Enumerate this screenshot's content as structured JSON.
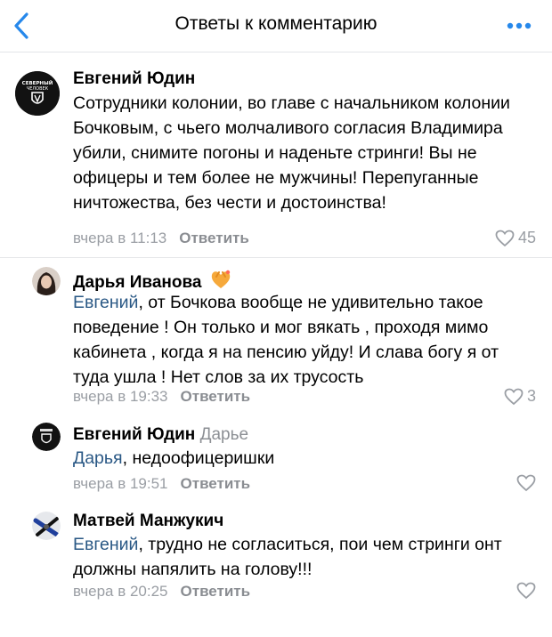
{
  "header": {
    "title": "Ответы к комментарию"
  },
  "comments": [
    {
      "author": "Евгений Юдин",
      "reply_to": "",
      "mention": "",
      "text": "Сотрудники колонии, во главе с начальником колонии Бочковым, с чьего молчаливого согласия Владимира убили, снимите погоны и наденьте стринги! Вы не офицеры и тем более не мужчины! Перепуганные ничтожества, без чести и достоинства!",
      "time": "вчера в 11:13",
      "reply_label": "Ответить",
      "likes": "45",
      "avatar_icon": "group-logo-icon",
      "avatar_text": "СЕВЕРНЫЙ ЧЕЛОВЕК"
    },
    {
      "author": "Дарья Иванова",
      "reply_to": "",
      "mention": "Евгений",
      "text": ", от Бочкова вообще не удивительно такое поведение ! Он только и мог вякать , проходя мимо кабинета , когда я на пенсию уйду! И слава богу я от туда ушла ! Нет слов за их трусость",
      "time": "вчера в 19:33",
      "reply_label": "Ответить",
      "likes": "3",
      "avatar_icon": "user-photo-icon",
      "badge_icon": "heart-hands-emoji-icon"
    },
    {
      "author": "Евгений Юдин",
      "reply_to": "Дарье",
      "mention": "Дарья",
      "text": ", недоофицеришки",
      "time": "вчера в 19:51",
      "reply_label": "Ответить",
      "likes": "",
      "avatar_icon": "group-logo-icon"
    },
    {
      "author": "Матвей Манжукич",
      "reply_to": "",
      "mention": "Евгений",
      "text": ", трудно не согласиться, пои чем стринги онт должны напялить на голову!!!",
      "time": "вчера в 20:25",
      "reply_label": "Ответить",
      "likes": "",
      "avatar_icon": "user-photo-icon"
    }
  ],
  "icons": {
    "back": "chevron-left-icon",
    "more": "more-dots-icon",
    "like": "heart-outline-icon"
  },
  "colors": {
    "accent": "#2688eb",
    "mention": "#2a5885",
    "meta": "#9a9ea4"
  }
}
